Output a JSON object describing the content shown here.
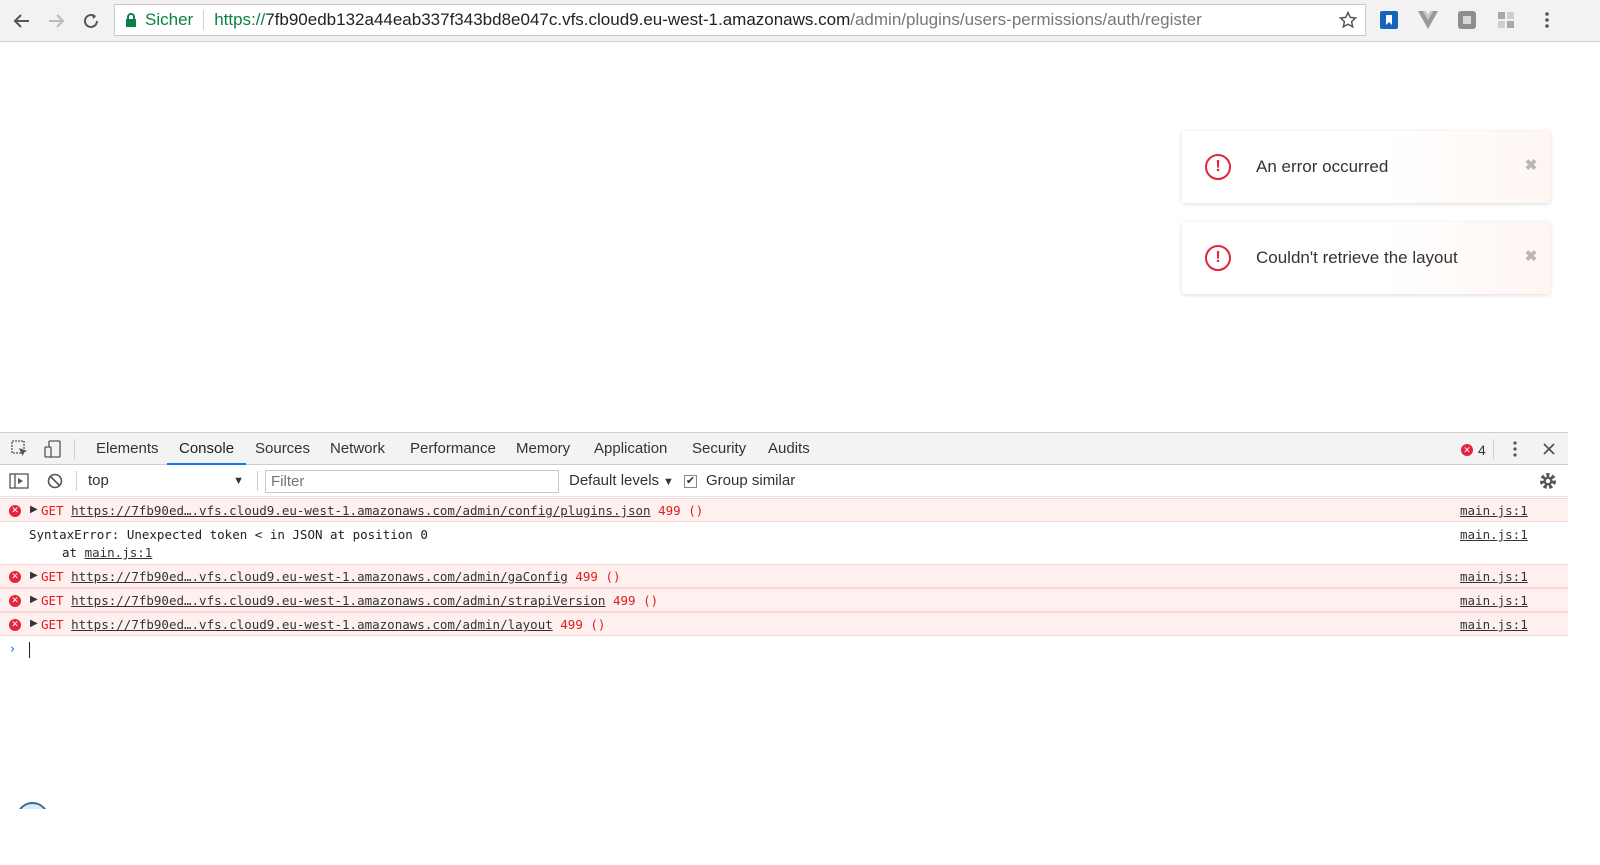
{
  "browser": {
    "secure_label": "Sicher",
    "url_scheme": "https://",
    "url_host": "7fb90edb132a44eab337f343bd8e047c.vfs.cloud9.eu-west-1.amazonaws.com",
    "url_path": "/admin/plugins/users-permissions/auth/register"
  },
  "notifications": [
    {
      "message": "An error occurred",
      "icon": "!",
      "close": "✖"
    },
    {
      "message": "Couldn't retrieve the layout",
      "icon": "!",
      "close": "✖"
    }
  ],
  "devtools": {
    "tabs": [
      "Elements",
      "Console",
      "Sources",
      "Network",
      "Performance",
      "Memory",
      "Application",
      "Security",
      "Audits"
    ],
    "active_tab": "Console",
    "error_count": "4",
    "context": "top",
    "filter_placeholder": "Filter",
    "levels": "Default levels",
    "group_similar": "Group similar",
    "group_similar_checked": true
  },
  "console": [
    {
      "type": "error",
      "method": "GET",
      "url": "https://7fb90ed….vfs.cloud9.eu-west-1.amazonaws.com/admin/config/plugins.json",
      "status": "499 ()",
      "source": "main.js:1"
    },
    {
      "type": "log",
      "text": "SyntaxError: Unexpected token < in JSON at position 0",
      "at_prefix": "at ",
      "at_link": "main.js:1",
      "source": "main.js:1"
    },
    {
      "type": "error",
      "method": "GET",
      "url": "https://7fb90ed….vfs.cloud9.eu-west-1.amazonaws.com/admin/gaConfig",
      "status": "499 ()",
      "source": "main.js:1"
    },
    {
      "type": "error",
      "method": "GET",
      "url": "https://7fb90ed….vfs.cloud9.eu-west-1.amazonaws.com/admin/strapiVersion",
      "status": "499 ()",
      "source": "main.js:1"
    },
    {
      "type": "error",
      "method": "GET",
      "url": "https://7fb90ed….vfs.cloud9.eu-west-1.amazonaws.com/admin/layout",
      "status": "499 ()",
      "source": "main.js:1"
    }
  ],
  "prompt_symbol": "›",
  "colors": {
    "secure_green": "#0b8043",
    "error_red": "#e4233a",
    "active_tab_blue": "#1a73e8",
    "error_row_bg": "#fff0f0"
  }
}
